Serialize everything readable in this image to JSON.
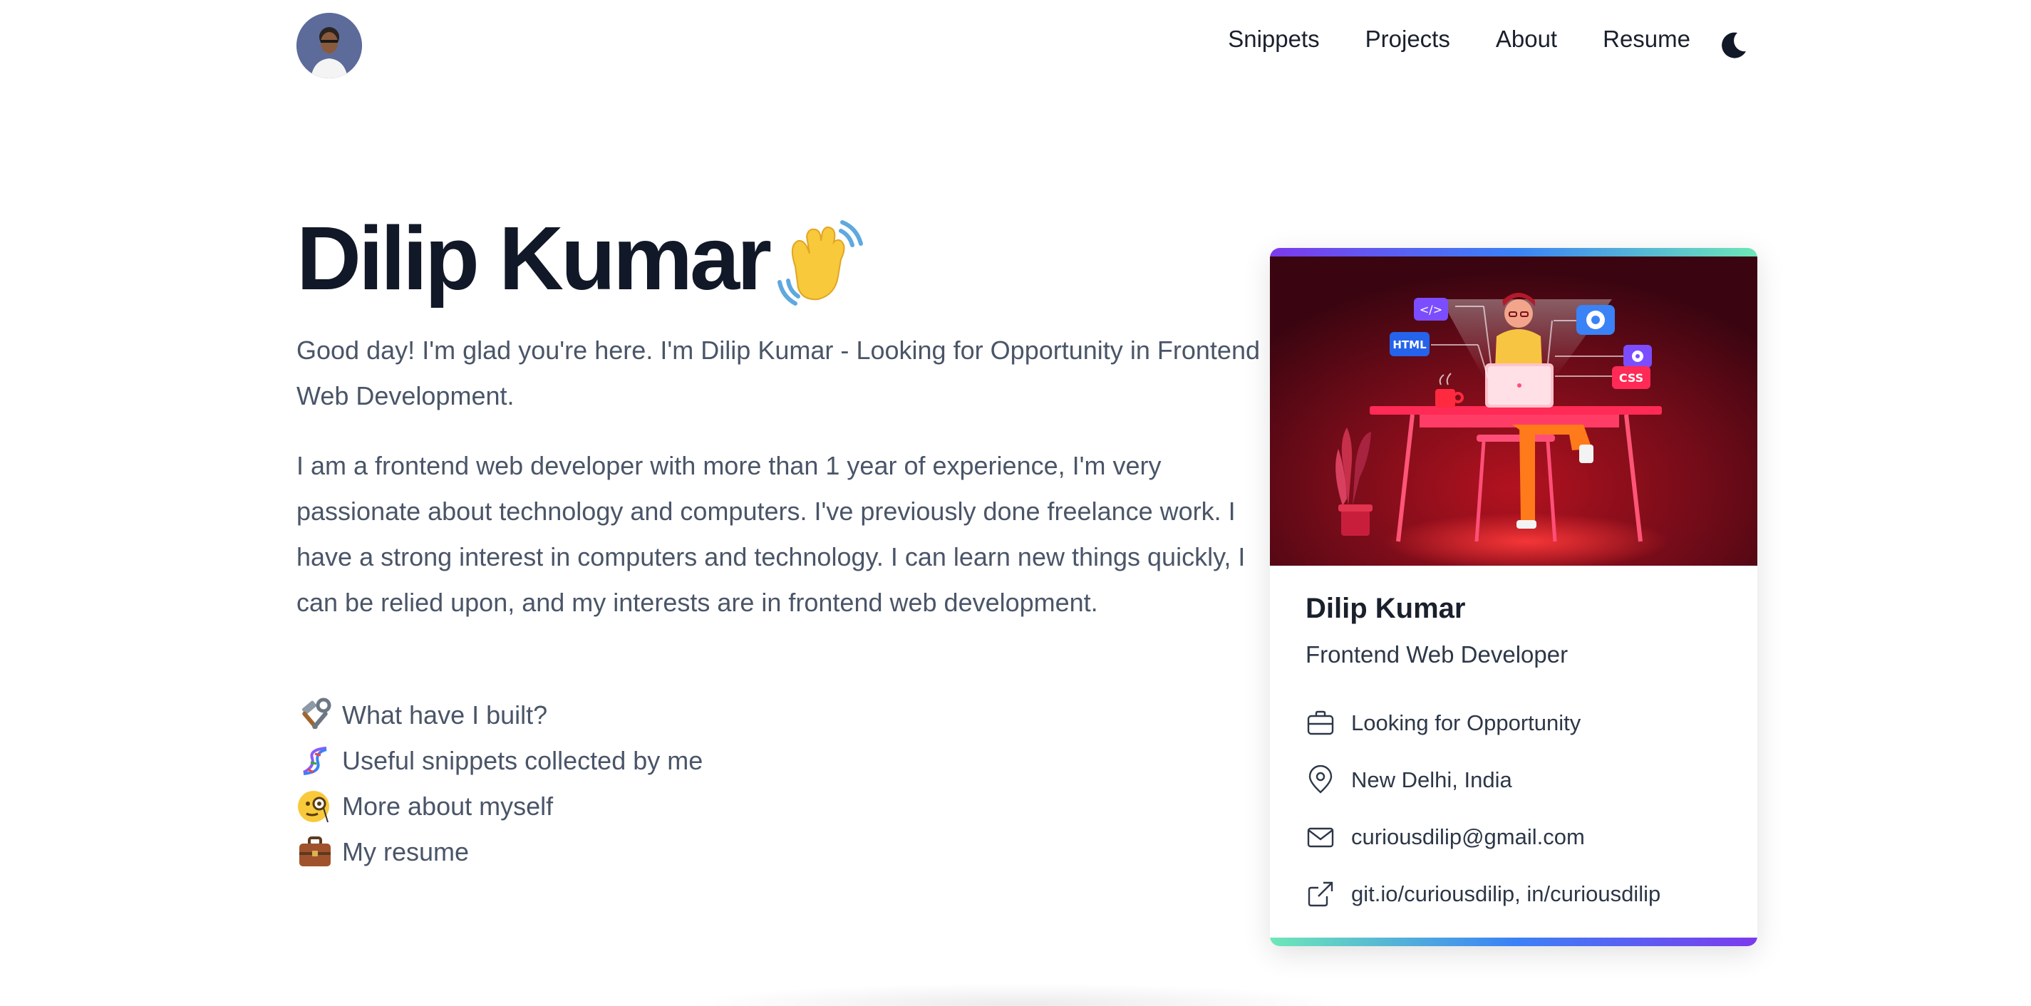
{
  "nav": {
    "avatar_alt": "Dilip Kumar avatar",
    "links": [
      "Snippets",
      "Projects",
      "About",
      "Resume"
    ],
    "theme_toggle": "moon-icon"
  },
  "hero": {
    "title": "Dilip Kumar",
    "intro": "Good day! I'm glad you're here. I'm Dilip Kumar - Looking for Opportunity in Frontend Web Development.",
    "bio": "I am a frontend web developer with more than 1 year of experience, I'm very passionate about technology and computers. I've previously done freelance work. I have a strong interest in computers and technology. I can learn new things quickly, I can be relied upon, and my interests are in frontend web development.",
    "links": [
      {
        "icon": "hammer-wrench-icon",
        "text": "What have I built?"
      },
      {
        "icon": "dna-icon",
        "text": "Useful snippets collected by me"
      },
      {
        "icon": "monocle-face-icon",
        "text": "More about myself"
      },
      {
        "icon": "briefcase-icon",
        "text": "My resume"
      }
    ]
  },
  "card": {
    "name": "Dilip Kumar",
    "role": "Frontend Web Developer",
    "status": "Looking for Opportunity",
    "location": "New Delhi, India",
    "email": "curiousdilip@gmail.com",
    "profiles": "git.io/curiousdilip, in/curiousdilip",
    "illustration_tags": [
      "</>",
      "HTML",
      "CSS"
    ]
  },
  "colors": {
    "gradient_start": "#7c3aed",
    "gradient_mid": "#3b82f6",
    "gradient_end": "#6ee7b7",
    "illustration_bg": "#5c0a14",
    "accent_red": "#ff2a55"
  }
}
